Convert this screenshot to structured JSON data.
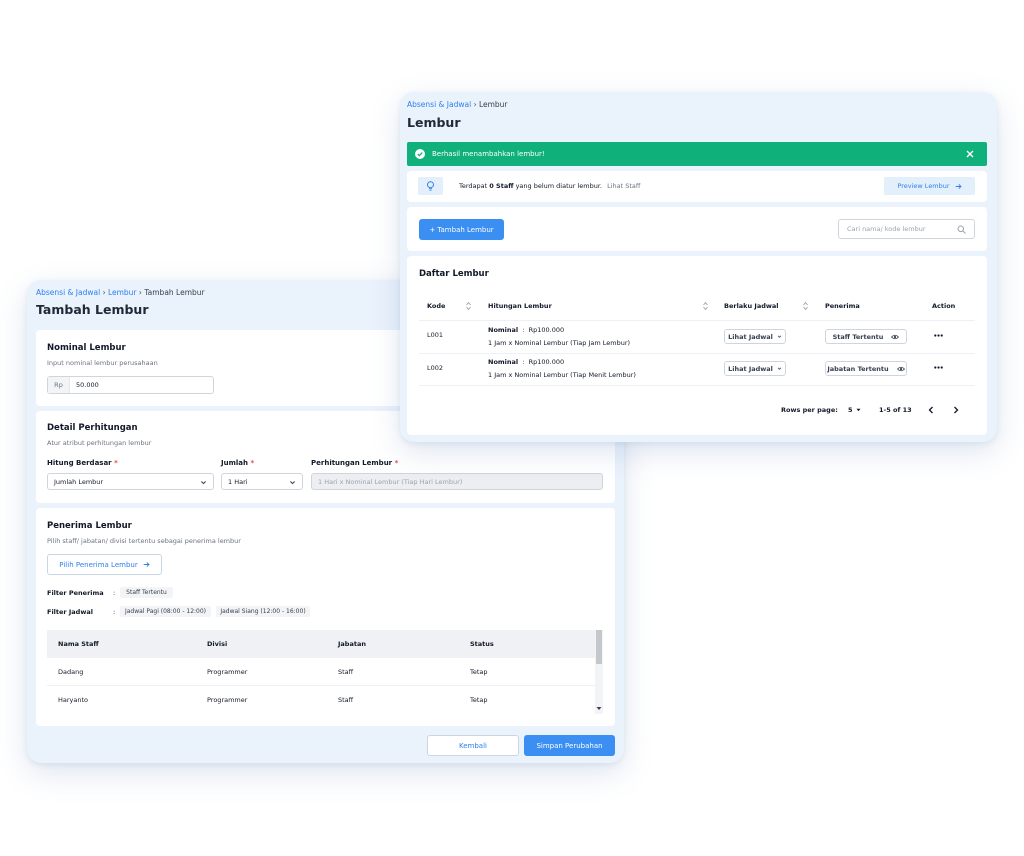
{
  "tambah": {
    "breadcrumb": [
      "Absensi & Jadwal",
      "Lembur",
      "Tambah Lembur"
    ],
    "title": "Tambah Lembur",
    "nominal": {
      "title": "Nominal Lembur",
      "subtitle": "Input nominal lembur perusahaan",
      "prefix": "Rp",
      "value": "50.000"
    },
    "detail": {
      "title": "Detail Perhitungan",
      "subtitle": "Atur atribut perhitungan lembur",
      "hitung_label": "Hitung Berdasar",
      "hitung_value": "Jumlah Lembur",
      "jumlah_label": "Jumlah",
      "jumlah_value": "1 Hari",
      "perhitungan_label": "Perhitungan Lembur",
      "perhitungan_value": "1 Hari x Nominal Lembur (Tiap Hari Lembur)"
    },
    "penerima": {
      "title": "Penerima Lembur",
      "subtitle": "Pilih staff/ jabatan/ divisi tertentu sebagai penerima lembur",
      "pilih_button": "Pilih Penerima Lembur",
      "filter_penerima_label": "Filter Penerima",
      "filter_penerima_chips": [
        "Staff Tertentu"
      ],
      "filter_jadwal_label": "Filter Jadwal",
      "filter_jadwal_chips": [
        "Jadwal Pagi (08:00 - 12:00)",
        "Jadwal Siang (12:00 - 16:00)"
      ],
      "colon": ":",
      "columns": [
        "Nama Staff",
        "Divisi",
        "Jabatan",
        "Status"
      ],
      "rows": [
        [
          "Dadang",
          "Programmer",
          "Staff",
          "Tetap"
        ],
        [
          "Haryanto",
          "Programmer",
          "Staff",
          "Tetap"
        ]
      ]
    },
    "footer": {
      "kembali": "Kembali",
      "simpan": "Simpan Perubahan"
    }
  },
  "lembur": {
    "breadcrumb": [
      "Absensi & Jadwal",
      "Lembur"
    ],
    "title": "Lembur",
    "alert": "Berhasil menambahkan lembur!",
    "info": {
      "prefix": "Terdapat ",
      "bold": "0 Staff",
      "suffix": " yang belum diatur lembur.",
      "link": "Lihat Staff",
      "preview_button": "Preview Lembur"
    },
    "tambah_button": "+ Tambah Lembur",
    "search_placeholder": "Cari nama/ kode lembur",
    "list_title": "Daftar Lembur",
    "columns": [
      "Kode",
      "Hitungan Lembur",
      "Berlaku Jadwal",
      "Penerima",
      "Action"
    ],
    "rows": [
      {
        "kode": "L001",
        "nominal_label": "Nominal",
        "nominal_value": "Rp100.000",
        "formula": "1 Jam x Nominal Lembur (Tiap Jam Lembur)",
        "jadwal": "Lihat Jadwal",
        "penerima": "Staff Tertentu"
      },
      {
        "kode": "L002",
        "nominal_label": "Nominal",
        "nominal_value": "Rp100.000",
        "formula": "1 Jam x Nominal Lembur (Tiap Menit Lembur)",
        "jadwal": "Lihat Jadwal",
        "penerima": "Jabatan Tertentu"
      }
    ],
    "pagination": {
      "rows_label": "Rows per page:",
      "rows_value": "5",
      "range": "1-5 of 13"
    }
  },
  "colors": {
    "primary": "#3b8ff3",
    "success": "#0fb07a",
    "panel_bg": "#eaf2fc"
  },
  "icons": [
    "check-circle-icon",
    "close-icon",
    "lightbulb-icon",
    "arrow-right-icon",
    "search-icon",
    "sort-icon",
    "chevron-down-icon",
    "eye-icon",
    "more-icon",
    "chevron-left-icon",
    "chevron-right-icon",
    "caret-down-icon"
  ]
}
